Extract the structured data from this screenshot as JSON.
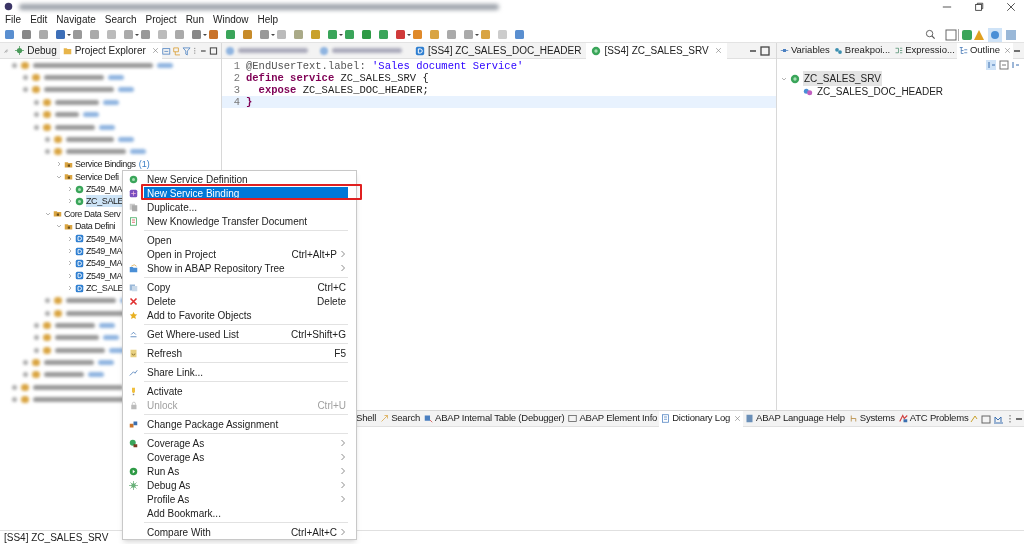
{
  "menu_bar": [
    "File",
    "Edit",
    "Navigate",
    "Search",
    "Project",
    "Run",
    "Window",
    "Help"
  ],
  "left_panel": {
    "tabs": [
      {
        "label": "Debug",
        "selected": false
      },
      {
        "label": "Project Explorer",
        "selected": true
      }
    ],
    "tree": [
      {
        "kind": "folder",
        "redacted": true,
        "expanded": true,
        "selected": false,
        "children": [
          {
            "kind": "folder",
            "label": "Service Bindings",
            "count": "(1)",
            "expanded": false,
            "selected": false
          },
          {
            "kind": "folder",
            "label": "Service Defi",
            "expanded": true,
            "selected": false,
            "children": [
              {
                "kind": "service",
                "label": "Z549_MA",
                "expanded": false,
                "selected": false
              },
              {
                "kind": "service",
                "label": "ZC_SALE",
                "expanded": false,
                "selected": true
              }
            ]
          }
        ]
      },
      {
        "kind": "folder",
        "label": "Core Data Serv",
        "expanded": true,
        "selected": false,
        "children": [
          {
            "kind": "folder",
            "label": "Data Defini",
            "expanded": true,
            "selected": false,
            "children": [
              {
                "kind": "ddl",
                "label": "Z549_MA",
                "expanded": false,
                "selected": false
              },
              {
                "kind": "ddl",
                "label": "Z549_MA",
                "expanded": false,
                "selected": false
              },
              {
                "kind": "ddl",
                "label": "Z549_MA",
                "expanded": false,
                "selected": false
              },
              {
                "kind": "ddl",
                "label": "Z549_MA",
                "expanded": false,
                "selected": false
              },
              {
                "kind": "ddl",
                "label": "ZC_SALE",
                "expanded": false,
                "selected": false
              }
            ]
          }
        ]
      }
    ]
  },
  "editor": {
    "tabs": [
      {
        "kind": "redacted",
        "selected": false
      },
      {
        "kind": "redacted",
        "selected": false
      },
      {
        "kind": "ddl",
        "label": "[SS4] ZC_SALES_DOC_HEADER",
        "selected": false
      },
      {
        "kind": "service",
        "label": "[SS4] ZC_SALES_SRV",
        "selected": true
      }
    ],
    "lines": [
      {
        "number": "1",
        "current": false,
        "tokens": [
          {
            "kind": "annotation",
            "text": "@EndUserText.label: "
          },
          {
            "kind": "string",
            "text": "'Sales document Service'"
          }
        ]
      },
      {
        "number": "2",
        "current": false,
        "tokens": [
          {
            "kind": "keyword",
            "text": "define service "
          },
          {
            "kind": "plain",
            "text": "ZC_SALES_SRV {"
          }
        ]
      },
      {
        "number": "3",
        "current": false,
        "tokens": [
          {
            "kind": "keyword",
            "text": "  expose "
          },
          {
            "kind": "plain",
            "text": "ZC_SALES_DOC_HEADER;"
          }
        ]
      },
      {
        "number": "4",
        "current": true,
        "tokens": [
          {
            "kind": "keyword",
            "text": "}"
          }
        ]
      }
    ]
  },
  "right_panel": {
    "tabs": [
      {
        "label": "Variables",
        "selected": false
      },
      {
        "label": "Breakpoi...",
        "selected": false
      },
      {
        "label": "Expressio...",
        "selected": false
      },
      {
        "label": "Outline",
        "selected": true
      }
    ],
    "outline": [
      {
        "label": "ZC_SALES_SRV",
        "expanded": true,
        "selected": true,
        "children": [
          {
            "label": "ZC_SALES_DOC_HEADER",
            "selected": false
          }
        ]
      }
    ]
  },
  "bottom_panel": {
    "tabs": [
      {
        "label": "Shell",
        "selected": false
      },
      {
        "label": "Search",
        "selected": false
      },
      {
        "label": "ABAP Internal Table (Debugger)",
        "selected": false
      },
      {
        "label": "ABAP Element Info",
        "selected": false
      },
      {
        "label": "Dictionary Log",
        "selected": true
      },
      {
        "label": "ABAP Language Help",
        "selected": false
      },
      {
        "label": "Systems",
        "selected": false
      },
      {
        "label": "ATC Problems",
        "selected": false
      }
    ]
  },
  "context_menu": [
    {
      "kind": "item",
      "label": "New Service Definition",
      "disabled": false,
      "selected": false
    },
    {
      "kind": "item",
      "label": "New Service Binding",
      "disabled": false,
      "selected": true
    },
    {
      "kind": "item",
      "label": "Duplicate...",
      "disabled": false,
      "selected": false
    },
    {
      "kind": "item",
      "label": "New Knowledge Transfer Document",
      "disabled": false,
      "selected": false
    },
    {
      "kind": "separator"
    },
    {
      "kind": "item",
      "label": "Open",
      "disabled": false,
      "selected": false
    },
    {
      "kind": "item",
      "label": "Open in Project",
      "shortcut": "Ctrl+Alt+P",
      "submenu": true,
      "disabled": false,
      "selected": false
    },
    {
      "kind": "item",
      "label": "Show in ABAP Repository Tree",
      "submenu": true,
      "disabled": false,
      "selected": false
    },
    {
      "kind": "separator"
    },
    {
      "kind": "item",
      "label": "Copy",
      "shortcut": "Ctrl+C",
      "disabled": false,
      "selected": false
    },
    {
      "kind": "item",
      "label": "Delete",
      "shortcut": "Delete",
      "disabled": false,
      "selected": false
    },
    {
      "kind": "item",
      "label": "Add to Favorite Objects",
      "disabled": false,
      "selected": false
    },
    {
      "kind": "separator"
    },
    {
      "kind": "item",
      "label": "Get Where-used List",
      "shortcut": "Ctrl+Shift+G",
      "disabled": false,
      "selected": false
    },
    {
      "kind": "separator"
    },
    {
      "kind": "item",
      "label": "Refresh",
      "shortcut": "F5",
      "disabled": false,
      "selected": false
    },
    {
      "kind": "separator"
    },
    {
      "kind": "item",
      "label": "Share Link...",
      "disabled": false,
      "selected": false
    },
    {
      "kind": "separator"
    },
    {
      "kind": "item",
      "label": "Activate",
      "disabled": false,
      "selected": false
    },
    {
      "kind": "item",
      "label": "Unlock",
      "shortcut": "Ctrl+U",
      "disabled": true,
      "selected": false
    },
    {
      "kind": "separator"
    },
    {
      "kind": "item",
      "label": "Change Package Assignment",
      "disabled": false,
      "selected": false
    },
    {
      "kind": "separator"
    },
    {
      "kind": "item",
      "label": "Coverage As",
      "submenu": true,
      "disabled": false,
      "selected": false
    },
    {
      "kind": "item",
      "label": "Coverage As",
      "submenu": true,
      "disabled": false,
      "selected": false
    },
    {
      "kind": "item",
      "label": "Run As",
      "submenu": true,
      "disabled": false,
      "selected": false
    },
    {
      "kind": "item",
      "label": "Debug As",
      "submenu": true,
      "disabled": false,
      "selected": false
    },
    {
      "kind": "item",
      "label": "Profile As",
      "submenu": true,
      "disabled": false,
      "selected": false
    },
    {
      "kind": "item",
      "label": "Add Bookmark...",
      "disabled": false,
      "selected": false
    },
    {
      "kind": "separator"
    },
    {
      "kind": "item",
      "label": "Compare With",
      "shortcut": "Ctrl+Alt+C",
      "submenu": true,
      "disabled": false,
      "selected": false
    }
  ],
  "status_bar": {
    "text": "[SS4] ZC_SALES_SRV"
  }
}
